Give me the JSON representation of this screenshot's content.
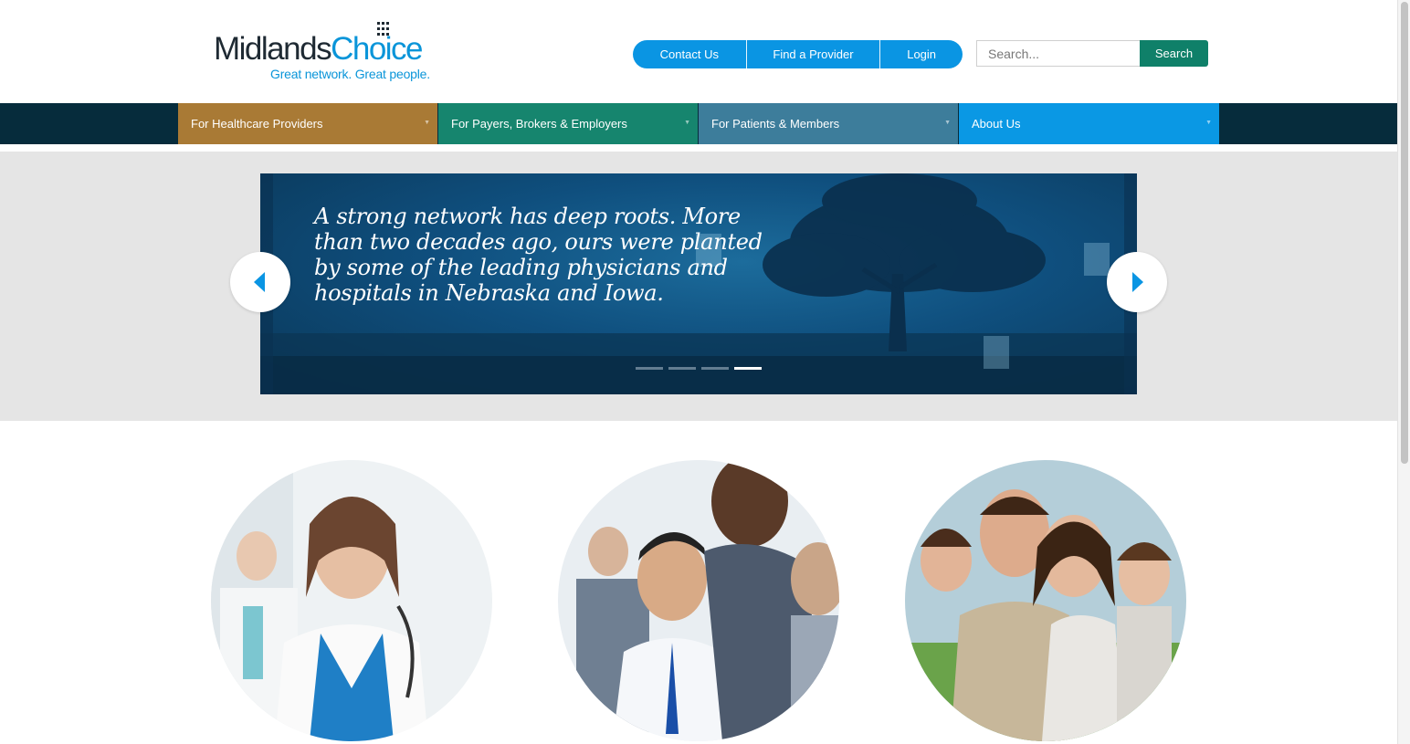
{
  "logo": {
    "word_1": "Midlands",
    "word_2": "Choice",
    "tagline": "Great network. Great people."
  },
  "header": {
    "links": [
      {
        "label": "Contact Us"
      },
      {
        "label": "Find a Provider"
      },
      {
        "label": "Login"
      }
    ],
    "search": {
      "placeholder": "Search...",
      "button": "Search"
    }
  },
  "nav": {
    "items": [
      {
        "label": "For Healthcare Providers",
        "color": "#a97a35"
      },
      {
        "label": "For Payers, Brokers & Employers",
        "color": "#16856e"
      },
      {
        "label": "For Patients & Members",
        "color": "#3d7d9b"
      },
      {
        "label": "About Us",
        "color": "#0a98e4"
      }
    ]
  },
  "carousel": {
    "quote": "A strong network has deep roots. More than two decades ago, ours were planted by some of the leading physicians and hospitals in Nebraska and Iowa.",
    "slide_count": 4,
    "active_slide": 4
  },
  "colors": {
    "brand_blue": "#0a95e3",
    "search_green": "#0f8069",
    "nav_background": "#062c3c",
    "hero_background": "#e5e5e5"
  },
  "icons": {
    "prev": "chevron-left-icon",
    "next": "chevron-right-icon"
  }
}
